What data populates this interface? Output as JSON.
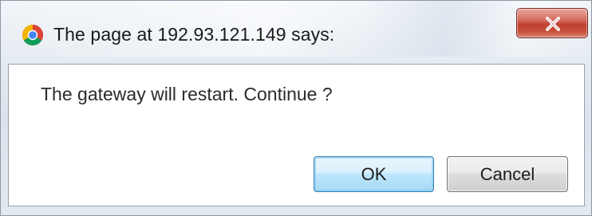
{
  "dialog": {
    "title": "The page at 192.93.121.149 says:",
    "message": "The gateway will restart. Continue ?",
    "close_icon": "close-x-icon",
    "app_icon": "chrome-browser-icon"
  },
  "buttons": {
    "ok_label": "OK",
    "cancel_label": "Cancel"
  },
  "colors": {
    "close_button": "#c9503d",
    "ok_button_border": "#3c7fb1",
    "dialog_background": "#ffffff"
  }
}
